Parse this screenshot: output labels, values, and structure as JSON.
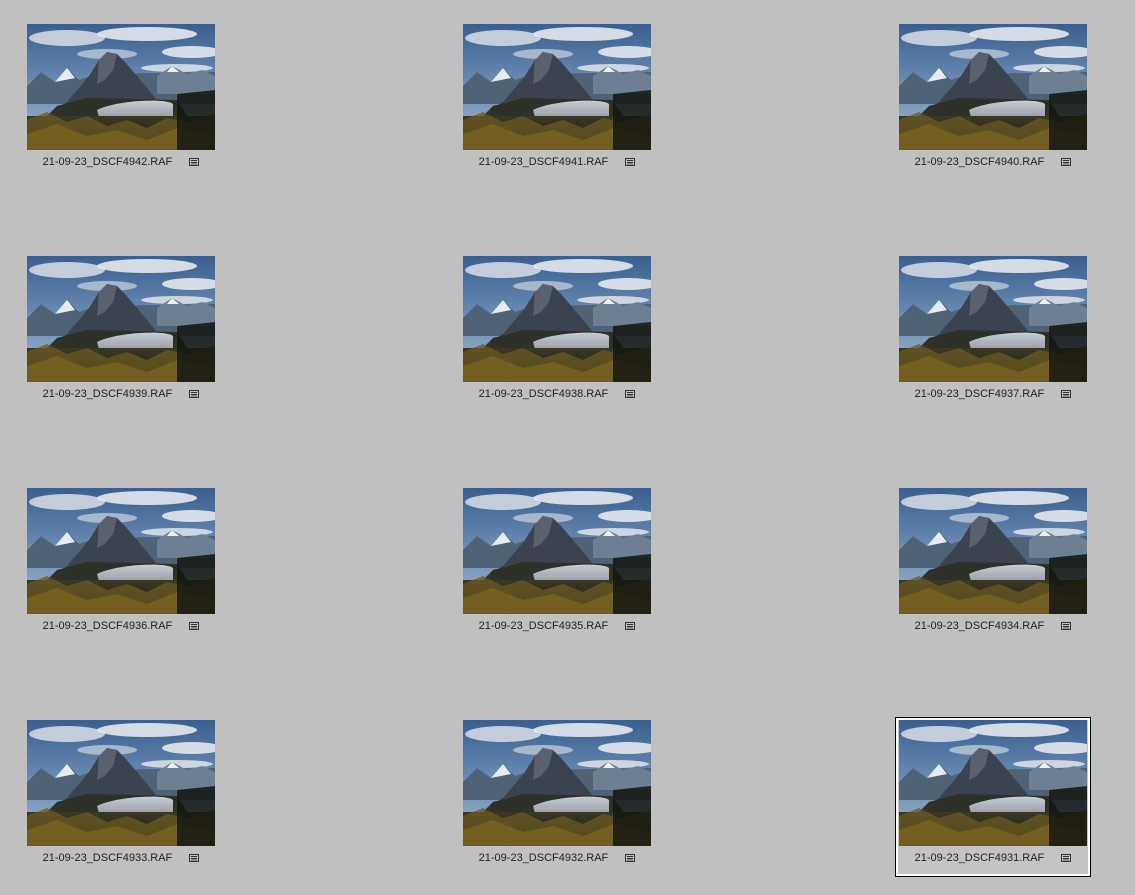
{
  "grid": {
    "items": [
      {
        "name": "21-09-23_DSCF4942.RAF",
        "selected": false
      },
      {
        "name": "21-09-23_DSCF4941.RAF",
        "selected": false
      },
      {
        "name": "21-09-23_DSCF4940.RAF",
        "selected": false
      },
      {
        "name": "21-09-23_DSCF4939.RAF",
        "selected": false
      },
      {
        "name": "21-09-23_DSCF4938.RAF",
        "selected": false
      },
      {
        "name": "21-09-23_DSCF4937.RAF",
        "selected": false
      },
      {
        "name": "21-09-23_DSCF4936.RAF",
        "selected": false
      },
      {
        "name": "21-09-23_DSCF4935.RAF",
        "selected": false
      },
      {
        "name": "21-09-23_DSCF4934.RAF",
        "selected": false
      },
      {
        "name": "21-09-23_DSCF4933.RAF",
        "selected": false
      },
      {
        "name": "21-09-23_DSCF4932.RAF",
        "selected": false
      },
      {
        "name": "21-09-23_DSCF4931.RAF",
        "selected": true
      }
    ],
    "badge_icon": "metadata-icon"
  },
  "colors": {
    "background": "#c0c0c0",
    "selection_outer": "#000000",
    "selection_inner": "#ffffff",
    "caption_text": "#222222"
  }
}
